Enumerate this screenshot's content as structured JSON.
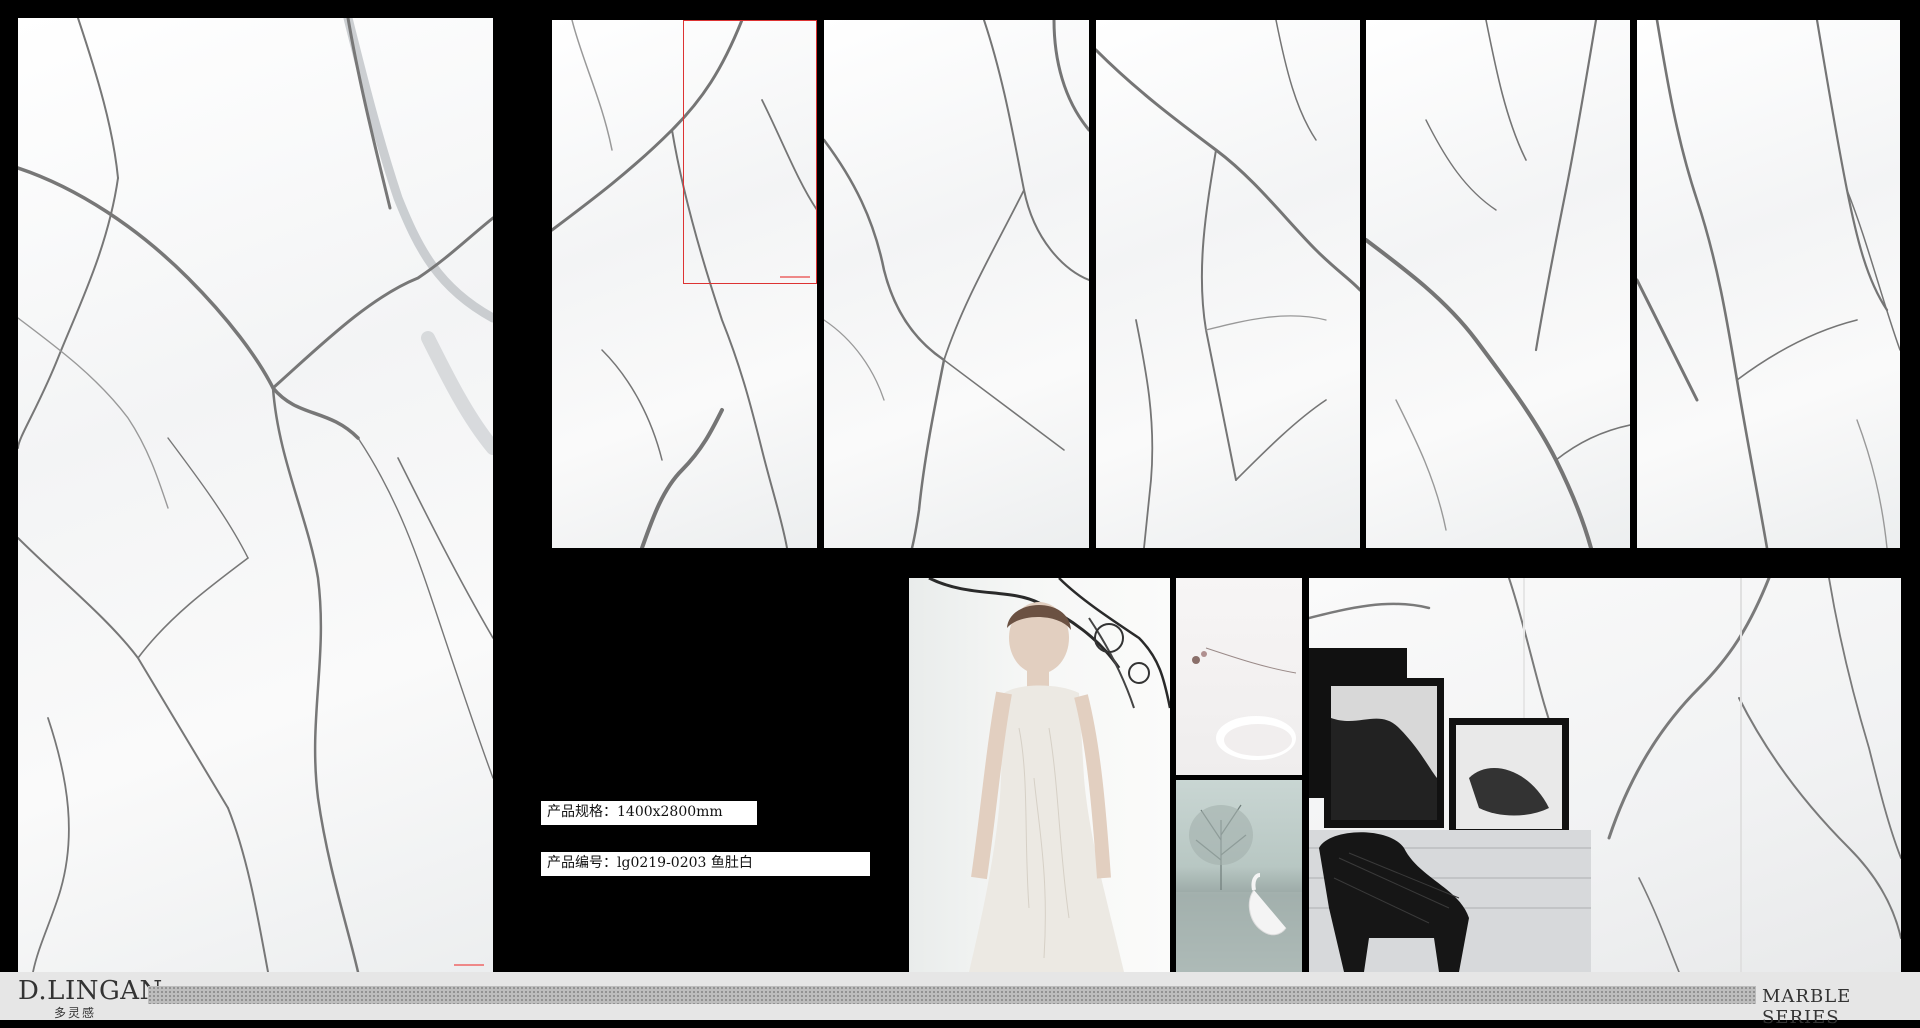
{
  "product": {
    "spec_label": "产品规格：1400x2800mm",
    "code_label": "产品编号：lg0219-0203 鱼肚白"
  },
  "footer": {
    "brand_name": "D.LINGAN",
    "brand_sub": "多灵感",
    "series": "MARBLE SERIES"
  },
  "colors": {
    "background": "#000000",
    "marble_vein": "#6e6e6e",
    "footer_bg": "#e6e6e6",
    "size_marker": "#dd3333"
  }
}
